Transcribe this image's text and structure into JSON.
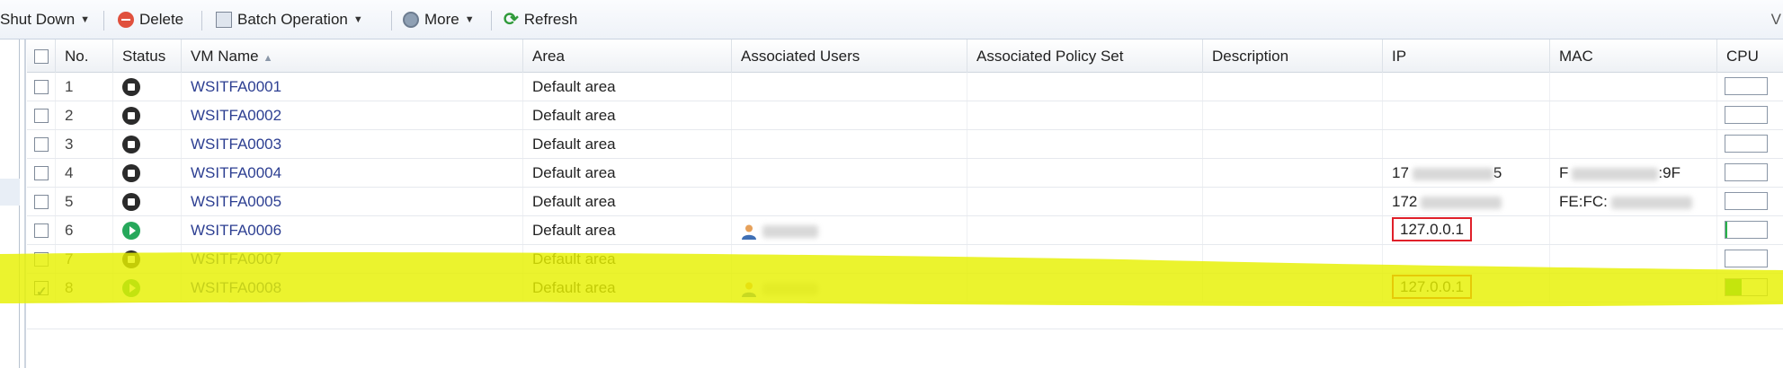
{
  "toolbar": {
    "shutdown_label": "Shut Down",
    "delete_label": "Delete",
    "batch_label": "Batch Operation",
    "more_label": "More",
    "refresh_label": "Refresh",
    "right_text": "V"
  },
  "table": {
    "columns": {
      "no": "No.",
      "status": "Status",
      "vm_name": "VM Name",
      "area": "Area",
      "users": "Associated Users",
      "policy": "Associated Policy Set",
      "description": "Description",
      "ip": "IP",
      "mac": "MAC",
      "cpu": "CPU"
    },
    "rows": [
      {
        "no": "1",
        "status": "stopped",
        "vm_name": "WSITFA0001",
        "area": "Default area",
        "user": "",
        "ip": "",
        "mac": "",
        "checked": false,
        "cpu": 0
      },
      {
        "no": "2",
        "status": "stopped",
        "vm_name": "WSITFA0002",
        "area": "Default area",
        "user": "",
        "ip": "",
        "mac": "",
        "checked": false,
        "cpu": 0
      },
      {
        "no": "3",
        "status": "stopped",
        "vm_name": "WSITFA0003",
        "area": "Default area",
        "user": "",
        "ip": "",
        "mac": "",
        "checked": false,
        "cpu": 0
      },
      {
        "no": "4",
        "status": "stopped",
        "vm_name": "WSITFA0004",
        "area": "Default area",
        "user": "",
        "ip": "17",
        "ip_tail": "5",
        "mac": "F",
        "mac_tail": ":9F",
        "checked": false,
        "cpu": 0
      },
      {
        "no": "5",
        "status": "stopped",
        "vm_name": "WSITFA0005",
        "area": "Default area",
        "user": "",
        "ip": "172",
        "mac": "FE:FC:",
        "checked": false,
        "cpu": 0
      },
      {
        "no": "6",
        "status": "running",
        "vm_name": "WSITFA0006",
        "area": "Default area",
        "user": "user",
        "ip": "127.0.0.1",
        "mac": "",
        "checked": false,
        "cpu": 0.05
      },
      {
        "no": "7",
        "status": "stopped",
        "vm_name": "WSITFA0007",
        "area": "Default area",
        "user": "",
        "ip": "",
        "mac": "",
        "checked": false,
        "cpu": 0
      },
      {
        "no": "8",
        "status": "running",
        "vm_name": "WSITFA0008",
        "area": "Default area",
        "user": "user",
        "ip": "127.0.0.1",
        "mac": "",
        "checked": true,
        "cpu": 0.4
      }
    ]
  },
  "colors": {
    "highlight": "#e6f000",
    "annotation_box": "#e0202a",
    "running": "#26a85b",
    "stopped": "#2b2b2b",
    "link": "#2d3f92"
  }
}
